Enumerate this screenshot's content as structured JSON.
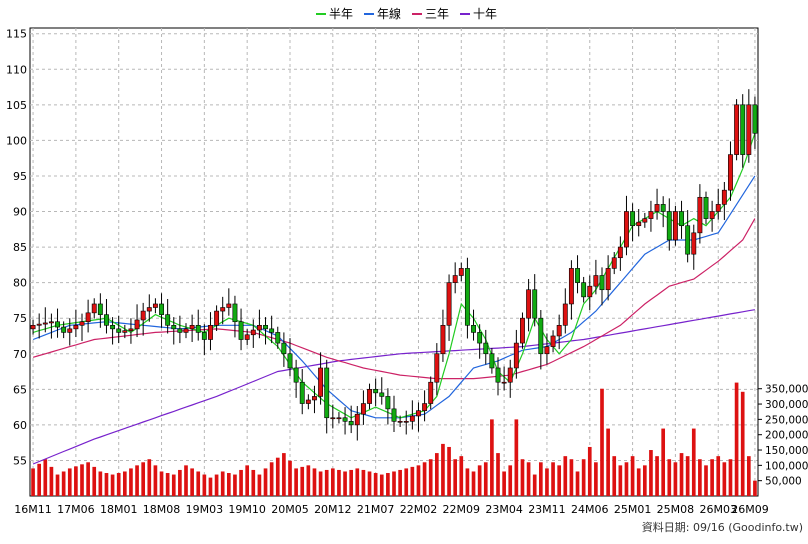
{
  "chart_data": {
    "type": "candlestick",
    "legend": {
      "placement": "top-center",
      "items": [
        {
          "label": "半年",
          "color": "#22cc22"
        },
        {
          "label": "年線",
          "color": "#2266dd"
        },
        {
          "label": "三年",
          "color": "#cc2266"
        },
        {
          "label": "十年",
          "color": "#7722cc"
        }
      ]
    },
    "price_axis": {
      "ticks": [
        55,
        60,
        65,
        70,
        75,
        80,
        85,
        90,
        95,
        100,
        105,
        110,
        115
      ],
      "min": 50,
      "max": 115.8
    },
    "volume_axis": {
      "ticks": [
        "50,000",
        "100,000",
        "150,000",
        "200,000",
        "250,000",
        "300,000",
        "350,000"
      ],
      "tick_values": [
        50000,
        100000,
        150000,
        200000,
        250000,
        300000,
        350000
      ],
      "max": 385000
    },
    "x_tick_labels": [
      "16M11",
      "17M06",
      "18M01",
      "18M08",
      "19M03",
      "19M10",
      "20M05",
      "20M12",
      "21M07",
      "22M02",
      "22M09",
      "23M04",
      "23M11",
      "24M06",
      "25M01",
      "25M08",
      "26M03",
      "26M09"
    ],
    "period_count": 119,
    "tick_every": 7,
    "close_anchors": [
      [
        0,
        74
      ],
      [
        3,
        74.5
      ],
      [
        5,
        73
      ],
      [
        8,
        74.5
      ],
      [
        10,
        77
      ],
      [
        12,
        74
      ],
      [
        14,
        73
      ],
      [
        16,
        73.5
      ],
      [
        18,
        76
      ],
      [
        20,
        77
      ],
      [
        22,
        74
      ],
      [
        24,
        73
      ],
      [
        26,
        74
      ],
      [
        28,
        72
      ],
      [
        30,
        76
      ],
      [
        32,
        77
      ],
      [
        34,
        72
      ],
      [
        37,
        74
      ],
      [
        39,
        73
      ],
      [
        41,
        70
      ],
      [
        43,
        66
      ],
      [
        44,
        63
      ],
      [
        46,
        64
      ],
      [
        47,
        68
      ],
      [
        48,
        61
      ],
      [
        50,
        61
      ],
      [
        52,
        60
      ],
      [
        54,
        63
      ],
      [
        55,
        65
      ],
      [
        57,
        64
      ],
      [
        59,
        60.5
      ],
      [
        61,
        60.5
      ],
      [
        63,
        62
      ],
      [
        64,
        63
      ],
      [
        65,
        66
      ],
      [
        66,
        70
      ],
      [
        67,
        74
      ],
      [
        68,
        80
      ],
      [
        70,
        82
      ],
      [
        71,
        74
      ],
      [
        72,
        73
      ],
      [
        74,
        70
      ],
      [
        76,
        66
      ],
      [
        77,
        66
      ],
      [
        78,
        68
      ],
      [
        80,
        75
      ],
      [
        81,
        79
      ],
      [
        82,
        75
      ],
      [
        83,
        70
      ],
      [
        84,
        71
      ],
      [
        86,
        74
      ],
      [
        87,
        77
      ],
      [
        88,
        82
      ],
      [
        90,
        78
      ],
      [
        92,
        81
      ],
      [
        93,
        79
      ],
      [
        94,
        82
      ],
      [
        96,
        85
      ],
      [
        97,
        90
      ],
      [
        98,
        88
      ],
      [
        100,
        89
      ],
      [
        101,
        90
      ],
      [
        102,
        91
      ],
      [
        103,
        90
      ],
      [
        104,
        86
      ],
      [
        105,
        90
      ],
      [
        106,
        88
      ],
      [
        107,
        84
      ],
      [
        108,
        87
      ],
      [
        109,
        92
      ],
      [
        110,
        89
      ],
      [
        112,
        91
      ],
      [
        113,
        93
      ],
      [
        114,
        98
      ],
      [
        115,
        105
      ],
      [
        116,
        98
      ],
      [
        117,
        105
      ],
      [
        118,
        101
      ]
    ],
    "volume_anchors": [
      [
        0,
        90000
      ],
      [
        2,
        120000
      ],
      [
        4,
        70000
      ],
      [
        6,
        90000
      ],
      [
        9,
        110000
      ],
      [
        11,
        80000
      ],
      [
        13,
        70000
      ],
      [
        15,
        80000
      ],
      [
        17,
        100000
      ],
      [
        19,
        120000
      ],
      [
        21,
        80000
      ],
      [
        23,
        70000
      ],
      [
        25,
        100000
      ],
      [
        27,
        80000
      ],
      [
        29,
        60000
      ],
      [
        31,
        80000
      ],
      [
        33,
        70000
      ],
      [
        35,
        100000
      ],
      [
        37,
        70000
      ],
      [
        39,
        110000
      ],
      [
        41,
        140000
      ],
      [
        43,
        90000
      ],
      [
        45,
        100000
      ],
      [
        47,
        80000
      ],
      [
        49,
        90000
      ],
      [
        51,
        80000
      ],
      [
        53,
        90000
      ],
      [
        55,
        80000
      ],
      [
        57,
        70000
      ],
      [
        59,
        80000
      ],
      [
        61,
        90000
      ],
      [
        63,
        100000
      ],
      [
        65,
        120000
      ],
      [
        66,
        140000
      ],
      [
        67,
        170000
      ],
      [
        68,
        160000
      ],
      [
        69,
        120000
      ],
      [
        70,
        130000
      ],
      [
        71,
        90000
      ],
      [
        72,
        80000
      ],
      [
        73,
        100000
      ],
      [
        74,
        110000
      ],
      [
        75,
        250000
      ],
      [
        76,
        140000
      ],
      [
        77,
        80000
      ],
      [
        78,
        100000
      ],
      [
        79,
        250000
      ],
      [
        80,
        120000
      ],
      [
        81,
        110000
      ],
      [
        82,
        70000
      ],
      [
        83,
        110000
      ],
      [
        84,
        90000
      ],
      [
        85,
        110000
      ],
      [
        86,
        100000
      ],
      [
        87,
        130000
      ],
      [
        88,
        120000
      ],
      [
        89,
        80000
      ],
      [
        90,
        120000
      ],
      [
        91,
        160000
      ],
      [
        92,
        110000
      ],
      [
        93,
        350000
      ],
      [
        94,
        220000
      ],
      [
        95,
        130000
      ],
      [
        96,
        100000
      ],
      [
        97,
        110000
      ],
      [
        98,
        130000
      ],
      [
        99,
        90000
      ],
      [
        100,
        100000
      ],
      [
        101,
        150000
      ],
      [
        102,
        130000
      ],
      [
        103,
        220000
      ],
      [
        104,
        120000
      ],
      [
        105,
        110000
      ],
      [
        106,
        140000
      ],
      [
        107,
        130000
      ],
      [
        108,
        220000
      ],
      [
        109,
        120000
      ],
      [
        110,
        100000
      ],
      [
        111,
        120000
      ],
      [
        112,
        130000
      ],
      [
        113,
        110000
      ],
      [
        114,
        120000
      ],
      [
        115,
        370000
      ],
      [
        116,
        340000
      ],
      [
        117,
        130000
      ],
      [
        118,
        50000
      ]
    ],
    "ma_half_year": [
      [
        0,
        73
      ],
      [
        4,
        74
      ],
      [
        8,
        74.5
      ],
      [
        12,
        75
      ],
      [
        16,
        73
      ],
      [
        20,
        75.5
      ],
      [
        24,
        74
      ],
      [
        28,
        73
      ],
      [
        32,
        75
      ],
      [
        36,
        74
      ],
      [
        40,
        71
      ],
      [
        44,
        66
      ],
      [
        48,
        63
      ],
      [
        52,
        61
      ],
      [
        56,
        62.5
      ],
      [
        60,
        61
      ],
      [
        64,
        62
      ],
      [
        66,
        64
      ],
      [
        68,
        70
      ],
      [
        70,
        77
      ],
      [
        72,
        75
      ],
      [
        74,
        72
      ],
      [
        76,
        67.5
      ],
      [
        78,
        66
      ],
      [
        80,
        70
      ],
      [
        82,
        75
      ],
      [
        84,
        72
      ],
      [
        86,
        70
      ],
      [
        88,
        72
      ],
      [
        90,
        77
      ],
      [
        92,
        79
      ],
      [
        94,
        82
      ],
      [
        96,
        85
      ],
      [
        98,
        88
      ],
      [
        100,
        89
      ],
      [
        102,
        90
      ],
      [
        104,
        89
      ],
      [
        106,
        88
      ],
      [
        108,
        89
      ],
      [
        110,
        88
      ],
      [
        112,
        90
      ],
      [
        114,
        92
      ],
      [
        116,
        96
      ],
      [
        118,
        101
      ]
    ],
    "ma_year": [
      [
        0,
        72
      ],
      [
        6,
        74
      ],
      [
        12,
        74.5
      ],
      [
        18,
        74
      ],
      [
        24,
        73.5
      ],
      [
        30,
        74
      ],
      [
        36,
        74
      ],
      [
        40,
        72.5
      ],
      [
        44,
        69
      ],
      [
        48,
        65
      ],
      [
        52,
        62
      ],
      [
        56,
        61
      ],
      [
        60,
        61
      ],
      [
        64,
        61.5
      ],
      [
        68,
        64
      ],
      [
        72,
        68
      ],
      [
        76,
        69
      ],
      [
        80,
        70.5
      ],
      [
        84,
        71
      ],
      [
        88,
        73
      ],
      [
        92,
        76
      ],
      [
        96,
        80
      ],
      [
        100,
        84
      ],
      [
        104,
        86
      ],
      [
        108,
        86
      ],
      [
        112,
        87
      ],
      [
        115,
        91
      ],
      [
        118,
        95
      ]
    ],
    "ma_three_year": [
      [
        0,
        69.5
      ],
      [
        10,
        72
      ],
      [
        20,
        73
      ],
      [
        30,
        73.5
      ],
      [
        36,
        73
      ],
      [
        42,
        71.5
      ],
      [
        48,
        69.5
      ],
      [
        54,
        68
      ],
      [
        60,
        67
      ],
      [
        66,
        66.5
      ],
      [
        72,
        66.5
      ],
      [
        78,
        67
      ],
      [
        84,
        68.5
      ],
      [
        90,
        71
      ],
      [
        96,
        74
      ],
      [
        100,
        77
      ],
      [
        104,
        79.5
      ],
      [
        108,
        80.5
      ],
      [
        112,
        83
      ],
      [
        116,
        86
      ],
      [
        118,
        89
      ]
    ],
    "ma_ten_year": [
      [
        0,
        54.5
      ],
      [
        10,
        58
      ],
      [
        20,
        61
      ],
      [
        30,
        64
      ],
      [
        40,
        67.5
      ],
      [
        50,
        69
      ],
      [
        60,
        70
      ],
      [
        70,
        70.5
      ],
      [
        80,
        71
      ],
      [
        90,
        72
      ],
      [
        100,
        73.5
      ],
      [
        110,
        75
      ],
      [
        118,
        76.2
      ]
    ],
    "footer_note": "資料日期: 09/16 (Goodinfo.tw)"
  }
}
